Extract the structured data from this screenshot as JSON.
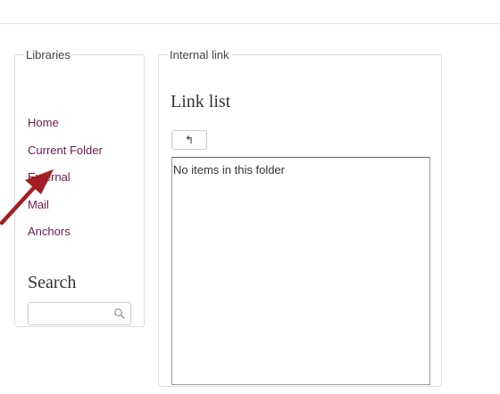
{
  "libraries": {
    "legend": "Libraries",
    "items": [
      {
        "label": "Home"
      },
      {
        "label": "Current Folder"
      },
      {
        "label": "External"
      },
      {
        "label": "Mail"
      },
      {
        "label": "Anchors"
      }
    ],
    "search": {
      "heading": "Search",
      "placeholder": "",
      "value": ""
    }
  },
  "internal_link": {
    "legend": "Internal link",
    "title": "Link list",
    "up_button_label": "↰",
    "empty_message": "No items in this folder"
  },
  "colors": {
    "link": "#6b1b4a",
    "arrow": "#a31d24",
    "border": "#dddddd"
  },
  "icons": {
    "search": "search-icon",
    "up": "folder-up-icon",
    "annotation": "arrow-pointer"
  }
}
